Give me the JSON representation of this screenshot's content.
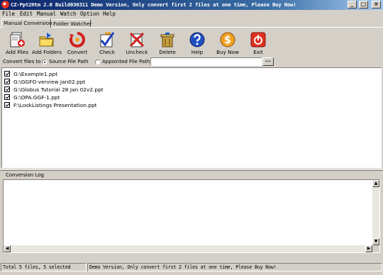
{
  "window": {
    "title": "CZ-Ppt2Htm 2.0 Build030311 Demo Version, Only convert first 2 files at one time, Please Buy Now!"
  },
  "menu": [
    "File",
    "Edit",
    "Manual",
    "Watch",
    "Option",
    "Help"
  ],
  "tabs": [
    "Manual Conversion",
    "Folder Watcher"
  ],
  "toolbar": [
    {
      "label": "Add Files",
      "icon": "add-files-icon"
    },
    {
      "label": "Add Folders",
      "icon": "add-folders-icon"
    },
    {
      "label": "Convert",
      "icon": "convert-icon"
    },
    {
      "label": "Check",
      "icon": "check-icon"
    },
    {
      "label": "Uncheck",
      "icon": "uncheck-icon"
    },
    {
      "label": "Delete",
      "icon": "delete-icon"
    },
    {
      "label": "Help",
      "icon": "help-icon"
    },
    {
      "label": "Buy Now",
      "icon": "buy-now-icon"
    },
    {
      "label": "Exit",
      "icon": "exit-icon"
    }
  ],
  "convert_row": {
    "label": "Convert files to :",
    "options": [
      "Source File Path",
      "Appointed File  Path"
    ],
    "selected": "Source File Path",
    "path_value": "",
    "browse_label": "..."
  },
  "files": [
    {
      "name": "G:\\Example1.ppt",
      "checked": true
    },
    {
      "name": "G:\\GGFO·verview Jan02.ppt",
      "checked": true
    },
    {
      "name": "G:\\Globus Tutorial 28 Jan 02v2.ppt",
      "checked": true
    },
    {
      "name": "G:\\OPA.GGF-1.ppt",
      "checked": true
    },
    {
      "name": "F:\\LookListings Presentation.ppt",
      "checked": true
    }
  ],
  "log": {
    "title": "Conversion Log",
    "content": ""
  },
  "status": {
    "left": "Total 5 files, 5 selected",
    "right": "Demo Version, Only convert first 2 files at one time, Please Buy Now!"
  },
  "colors": {
    "title_bar_start": "#0a246a",
    "title_bar_end": "#a6caf0",
    "face": "#d4d0c8"
  }
}
